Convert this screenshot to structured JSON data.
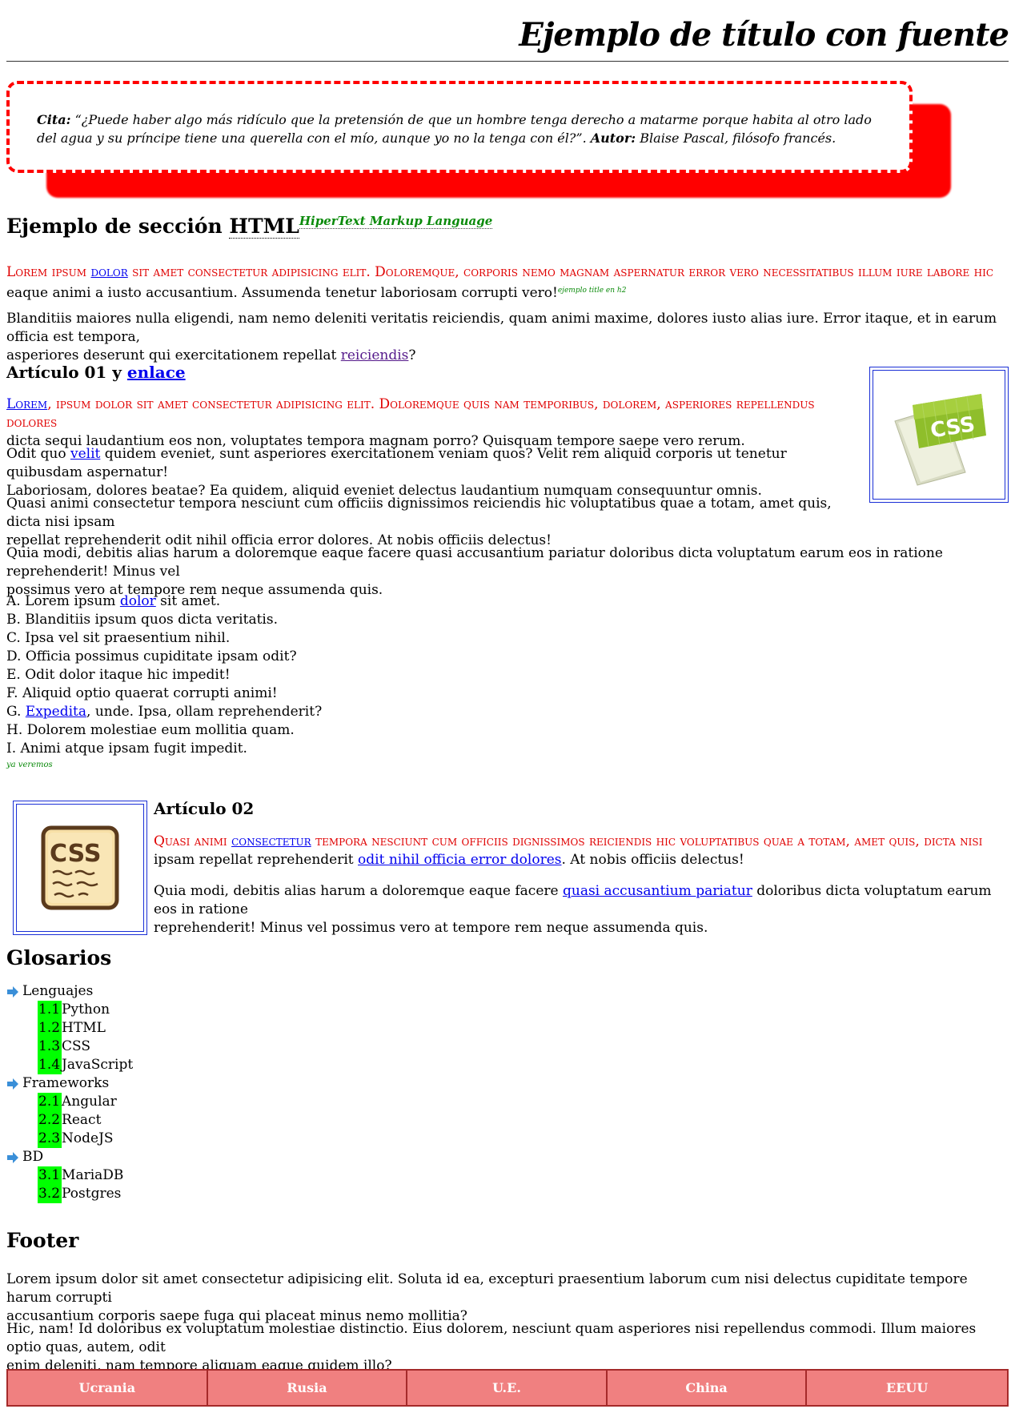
{
  "header": {
    "title": "Ejemplo de título con fuente"
  },
  "quote": {
    "label": "Cita:",
    "text": " “¿Puede haber algo más ridículo que la pretensión de que un hombre tenga derecho a matarme porque habita al otro lado del agua y su príncipe tiene una querella con el mío, aunque yo no la tenga con él?”. ",
    "author_label": "Autor:",
    "author": " Blaise Pascal, filósofo francés."
  },
  "section": {
    "title": "Ejemplo de sección ",
    "abbr": "HTML",
    "abbr_title": "HiperText Markup Language",
    "p1_a": "Lorem ipsum ",
    "p1_link": "dolor",
    "p1_b": " sit amet consectetur adipisicing elit. Doloremque, corporis nemo magnam aspernatur error vero necessitatibus illum iure labore hic",
    "p1_c": "eaque animi a iusto accusantium. Assumenda tenetur laboriosam corrupti vero!",
    "p1_note": "ejemplo title en h2",
    "p2_a": "Blanditiis maiores nulla eligendi, nam nemo deleniti veritatis reiciendis, quam animi maxime, dolores iusto alias iure. Error itaque, et in earum officia est tempora,",
    "p2_b": "asperiores deserunt qui exercitationem repellat ",
    "p2_link": "reiciendis",
    "p2_c": "?"
  },
  "article1": {
    "title": "Artículo 01 y ",
    "title_link": "enlace",
    "p1_link": "Lorem",
    "p1_a": ", ipsum dolor sit amet consectetur adipisicing elit. Doloremque quis nam temporibus, dolorem, asperiores repellendus dolores",
    "p1_b": "dicta sequi laudantium eos non, voluptates tempora magnam porro? Quisquam tempore saepe vero rerum.",
    "p2_a": "Odit quo ",
    "p2_link": "velit",
    "p2_b": " quidem eveniet, sunt asperiores exercitationem veniam quos? Velit rem aliquid corporis ut tenetur quibusdam aspernatur!",
    "p2_c": "Laboriosam, dolores beatae? Ea quidem, aliquid eveniet delectus laudantium numquam consequuntur omnis.",
    "p3_a": "Quasi animi consectetur tempora nesciunt cum officiis dignissimos reiciendis hic voluptatibus quae a totam, amet quis, dicta nisi ipsam",
    "p3_b": "repellat reprehenderit odit nihil officia error dolores. At nobis officiis delectus!",
    "p4_a": "Quia modi, debitis alias harum a doloremque eaque facere quasi accusantium pariatur doloribus dicta voluptatum earum eos in ratione reprehenderit! Minus vel",
    "p4_b": "possimus vero at tempore rem neque assumenda quis.",
    "list": {
      "a_pre": "A. Lorem ipsum ",
      "a_link": "dolor",
      "a_post": " sit amet.",
      "b": "B. Blanditiis ipsum quos dicta veritatis.",
      "c": "C. Ipsa vel sit praesentium nihil.",
      "d": "D. Officia possimus cupiditate ipsam odit?",
      "e": "E. Odit dolor itaque hic impedit!",
      "f": "F. Aliquid optio quaerat corrupti animi!",
      "g_pre": "G. ",
      "g_link": "Expedita",
      "g_post": ", unde. Ipsa, ollam reprehenderit?",
      "h": "H. Dolorem molestiae eum mollitia quam.",
      "i": "I. Animi atque ipsam fugit impedit."
    },
    "note": "ya veremos"
  },
  "article2": {
    "title": "Artículo 02",
    "p1_a": "Quasi animi ",
    "p1_link": "consectetur",
    "p1_b": " tempora nesciunt cum officiis dignissimos reiciendis hic voluptatibus quae a totam, amet quis, dicta nisi",
    "p1_c": "ipsam repellat reprehenderit ",
    "p1_link2": "odit nihil officia error dolores",
    "p1_d": ". At nobis officiis delectus!",
    "p2_a": "Quia modi, debitis alias harum a doloremque eaque facere ",
    "p2_link": "quasi accusantium pariatur",
    "p2_b": " doloribus dicta voluptatum earum eos in ratione",
    "p2_c": "reprehenderit! Minus vel possimus vero at tempore rem neque assumenda quis."
  },
  "glossary": {
    "title": "Glosarios",
    "cats": [
      "Lenguajes",
      "Frameworks",
      "BD"
    ],
    "lenguajes": [
      [
        "1.1",
        "Python"
      ],
      [
        "1.2",
        "HTML"
      ],
      [
        "1.3",
        "CSS"
      ],
      [
        "1.4",
        "JavaScript"
      ]
    ],
    "frameworks": [
      [
        "2.1",
        "Angular"
      ],
      [
        "2.2",
        "React"
      ],
      [
        "2.3",
        "NodeJS"
      ]
    ],
    "bd": [
      [
        "3.1",
        "MariaDB"
      ],
      [
        "3.2",
        "Postgres"
      ]
    ]
  },
  "footer": {
    "title": "Footer",
    "p1_a": "Lorem ipsum dolor sit amet consectetur adipisicing elit. Soluta id ea, excepturi praesentium laborum cum nisi delectus cupiditate tempore harum corrupti",
    "p1_b": "accusantium corporis saepe fuga qui placeat minus nemo mollitia?",
    "p2_a": "Hic, nam! Id doloribus ex voluptatum molestiae distinctio. Eius dolorem, nesciunt quam asperiores nisi repellendus commodi. Illum maiores optio quas, autem, odit",
    "p2_b": "enim deleniti, nam tempore aliquam eaque quidem illo?",
    "table": [
      "Ucrania",
      "Rusia",
      "U.E.",
      "China",
      "EEUU"
    ]
  },
  "colors": {
    "accent_red": "#ff0000",
    "highlight_green": "#00ff00",
    "table_bg": "#f08080",
    "table_border": "#a52a2a"
  },
  "images": {
    "article1": "css-document-icon",
    "article2": "css-parchment-icon"
  }
}
